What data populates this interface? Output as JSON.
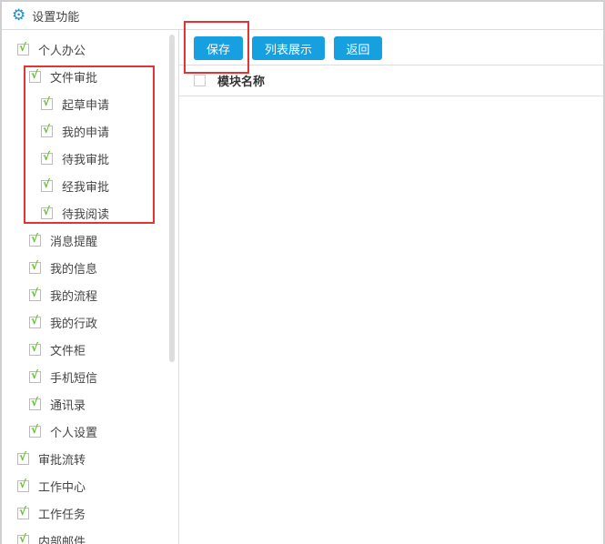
{
  "header": {
    "title": "设置功能",
    "icon": "gear-icon"
  },
  "toolbar": {
    "save": "保存",
    "list": "列表展示",
    "back": "返回"
  },
  "table": {
    "column": "模块名称"
  },
  "tree": [
    {
      "label": "个人办公",
      "level": 0
    },
    {
      "label": "文件审批",
      "level": 1
    },
    {
      "label": "起草申请",
      "level": 2
    },
    {
      "label": "我的申请",
      "level": 2
    },
    {
      "label": "待我审批",
      "level": 2
    },
    {
      "label": "经我审批",
      "level": 2
    },
    {
      "label": "待我阅读",
      "level": 2
    },
    {
      "label": "消息提醒",
      "level": 1
    },
    {
      "label": "我的信息",
      "level": 1
    },
    {
      "label": "我的流程",
      "level": 1
    },
    {
      "label": "我的行政",
      "level": 1
    },
    {
      "label": "文件柜",
      "level": 1
    },
    {
      "label": "手机短信",
      "level": 1
    },
    {
      "label": "通讯录",
      "level": 1
    },
    {
      "label": "个人设置",
      "level": 1
    },
    {
      "label": "审批流转",
      "level": 0
    },
    {
      "label": "工作中心",
      "level": 0
    },
    {
      "label": "工作任务",
      "level": 0
    },
    {
      "label": "内部邮件",
      "level": 0
    }
  ]
}
